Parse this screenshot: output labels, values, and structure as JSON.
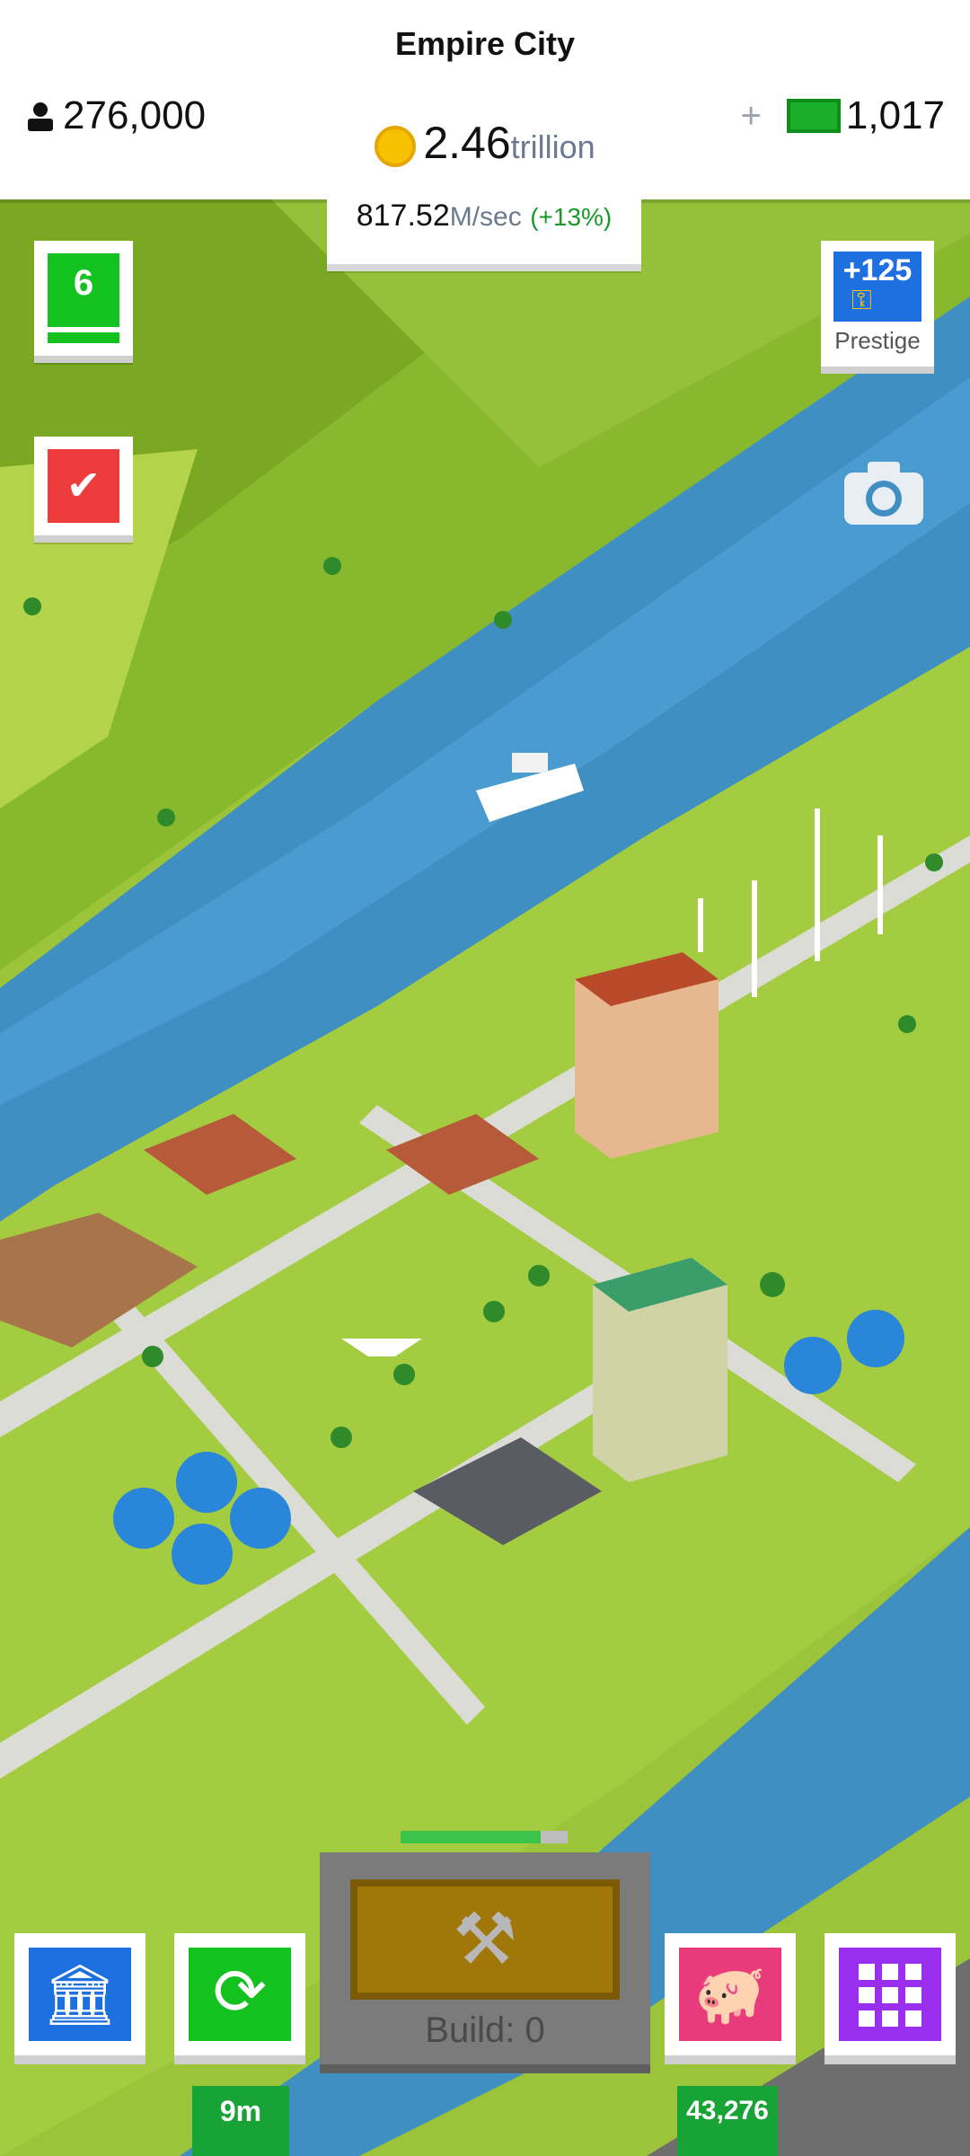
{
  "header": {
    "city_name": "Empire City",
    "population": "276,000",
    "gold_amount": "2.46",
    "gold_unit": "trillion",
    "cash_amount": "1,017",
    "plus_label": "+"
  },
  "income": {
    "amount": "817.52",
    "unit": "M/sec",
    "bonus": "(+13%)"
  },
  "level": {
    "value": "6"
  },
  "prestige": {
    "amount": "+125",
    "label": "Prestige"
  },
  "build": {
    "label": "Build: 0",
    "progress": 0.84
  },
  "bottom": {
    "boost_timer": "9m",
    "piggy_amount": "43,276"
  },
  "colors": {
    "grass": "#9cc43a",
    "river": "#3f8fc2",
    "accent_green": "#14c21f",
    "accent_blue": "#1e6fe0",
    "accent_red": "#ee3b3b",
    "accent_purple": "#9b2ff0"
  },
  "icons": [
    "person-icon",
    "gold-coin-icon",
    "cash-bill-icon",
    "checkmark-icon",
    "key-icon",
    "camera-icon",
    "hammer-icon",
    "bank-icon",
    "clock-refresh-icon",
    "piggy-bank-icon",
    "grid-menu-icon"
  ]
}
